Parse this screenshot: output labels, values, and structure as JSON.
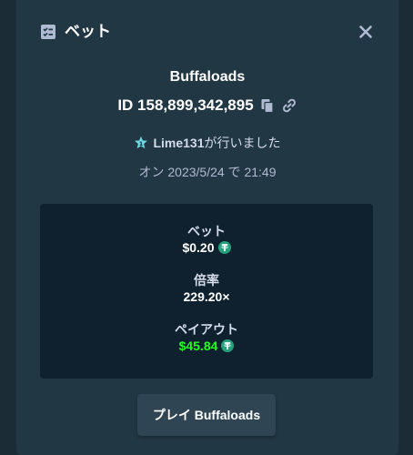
{
  "header": {
    "title": "ベット",
    "icon": "bet-slip-icon",
    "close_icon": "close-icon"
  },
  "game": {
    "title": "Buffaloads",
    "bet_id": "ID 158,899,342,895",
    "copy_icon": "copy-icon",
    "link_icon": "link-icon"
  },
  "placed_by": {
    "user": "Lime131",
    "suffix": "が行いました",
    "rank_icon": "rank-star-icon"
  },
  "date_text": "オン 2023/5/24 で 21:49",
  "stats": {
    "bet_label": "ベット",
    "bet_value": "$0.20",
    "multiplier_label": "倍率",
    "multiplier_value": "229.20×",
    "payout_label": "ペイアウト",
    "payout_value": "$45.84",
    "currency_icon": "tether-coin-icon"
  },
  "play_button": "プレイ Buffaloads",
  "colors": {
    "modal_bg": "#213743",
    "stats_bg": "#0f212e",
    "button_bg": "#2f4553",
    "payout_green": "#1fff20",
    "coin": "#26a17b"
  }
}
